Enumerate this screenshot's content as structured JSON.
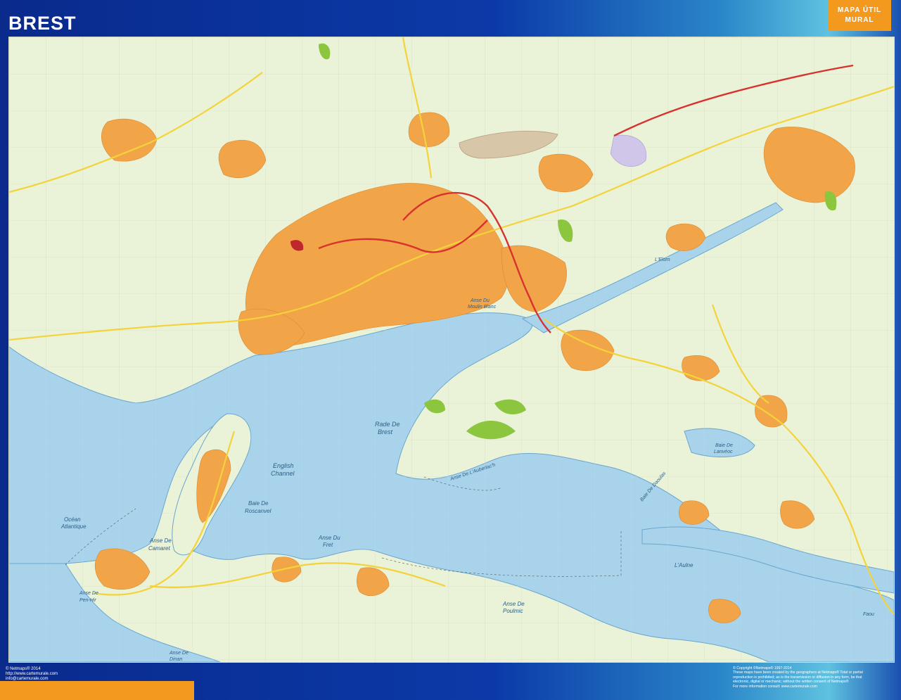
{
  "title": "BREST",
  "badge": {
    "line1": "MAPA ÚTIL",
    "line2": "MURAL"
  },
  "footer_left": {
    "copyright": "© Netmaps® 2014",
    "url": "http://www.cartemurale.com",
    "email": "info@cartemurale.com"
  },
  "footer_right": {
    "copyright": "© Copyright ©Netmaps® 1997-2014",
    "line1": "These maps have been created by the geographers at Netmaps® Total or partial",
    "line2": "reproduction is prohibited; as is the transmission or diffusion in any form, be that",
    "line3": "electronic, digital or mechanic; without the written consent of Netmaps®",
    "line4": "For more information consult: www.cartemurale.com"
  },
  "map_labels": {
    "rade_de_brest_1": "Rade De",
    "rade_de_brest_2": "Brest",
    "english_channel_1": "English",
    "english_channel_2": "Channel",
    "baie_roscanvel_1": "Baie De",
    "baie_roscanvel_2": "Roscanvel",
    "ocean_1": "Océan",
    "ocean_2": "Atlantique",
    "anse_camaret_1": "Anse De",
    "anse_camaret_2": "Camaret",
    "anse_fret_1": "Anse Du",
    "anse_fret_2": "Fret",
    "anse_poulmic_1": "Anse De",
    "anse_poulmic_2": "Poulmic",
    "anse_penhir_1": "Anse De",
    "anse_penhir_2": "Pen-Hir",
    "anse_dinan_1": "Anse De",
    "anse_dinan_2": "Dinan",
    "anse_moulin_blanc_1": "Anse Du",
    "anse_moulin_blanc_2": "Moulin Blanc",
    "anse_auberlac": "Anse De L'Auberlac'h",
    "baie_daoulas": "Baie De Daoulas",
    "anse_lanveoc_1": "Baie De",
    "anse_lanveoc_2": "Lanvéoc",
    "elorn": "L'Elorn",
    "aulne": "L'Aulne",
    "faou": "Faou"
  }
}
